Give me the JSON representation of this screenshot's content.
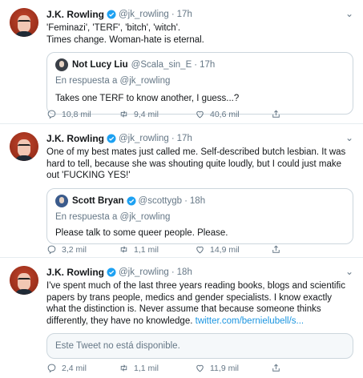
{
  "colors": {
    "verified_blue": "#1da1f2",
    "link_blue": "#1b95e0",
    "secondary_text": "#657786",
    "divider": "#e6ecf0"
  },
  "tweets": [
    {
      "name": "J.K. Rowling",
      "handle": "@jk_rowling",
      "time": "17h",
      "text_lines": [
        "'Feminazi', 'TERF', 'bitch', 'witch'.",
        "Times change. Woman-hate is eternal."
      ],
      "quote": {
        "name": "Not Lucy Liu",
        "verified": false,
        "handle": "@Scala_sin_E",
        "time": "17h",
        "reply_to": "En respuesta a @jk_rowling",
        "text": "Takes one TERF to know another, I guess...?"
      },
      "actions": {
        "replies": "10,8 mil",
        "retweets": "9,4 mil",
        "likes": "40,6 mil"
      }
    },
    {
      "name": "J.K. Rowling",
      "handle": "@jk_rowling",
      "time": "17h",
      "text": "One of my best mates just called me. Self-described butch lesbian. It was hard to tell, because she was shouting quite loudly, but I could just make out 'FUCKING YES!'",
      "quote": {
        "name": "Scott Bryan",
        "verified": true,
        "handle": "@scottygb",
        "time": "18h",
        "reply_to": "En respuesta a @jk_rowling",
        "text": "Please talk to some queer people. Please."
      },
      "actions": {
        "replies": "3,2 mil",
        "retweets": "1,1 mil",
        "likes": "14,9 mil"
      }
    },
    {
      "name": "J.K. Rowling",
      "handle": "@jk_rowling",
      "time": "18h",
      "text": "I've spent much of the last three years reading books, blogs and scientific papers by trans people, medics and gender specialists. I know exactly what the distinction is. Never assume that because someone thinks differently, they have no knowledge. ",
      "link": "twitter.com/bernielubell/s...",
      "unavailable": "Este Tweet no está disponible.",
      "actions": {
        "replies": "2,4 mil",
        "retweets": "1,1 mil",
        "likes": "11,9 mil"
      }
    }
  ]
}
